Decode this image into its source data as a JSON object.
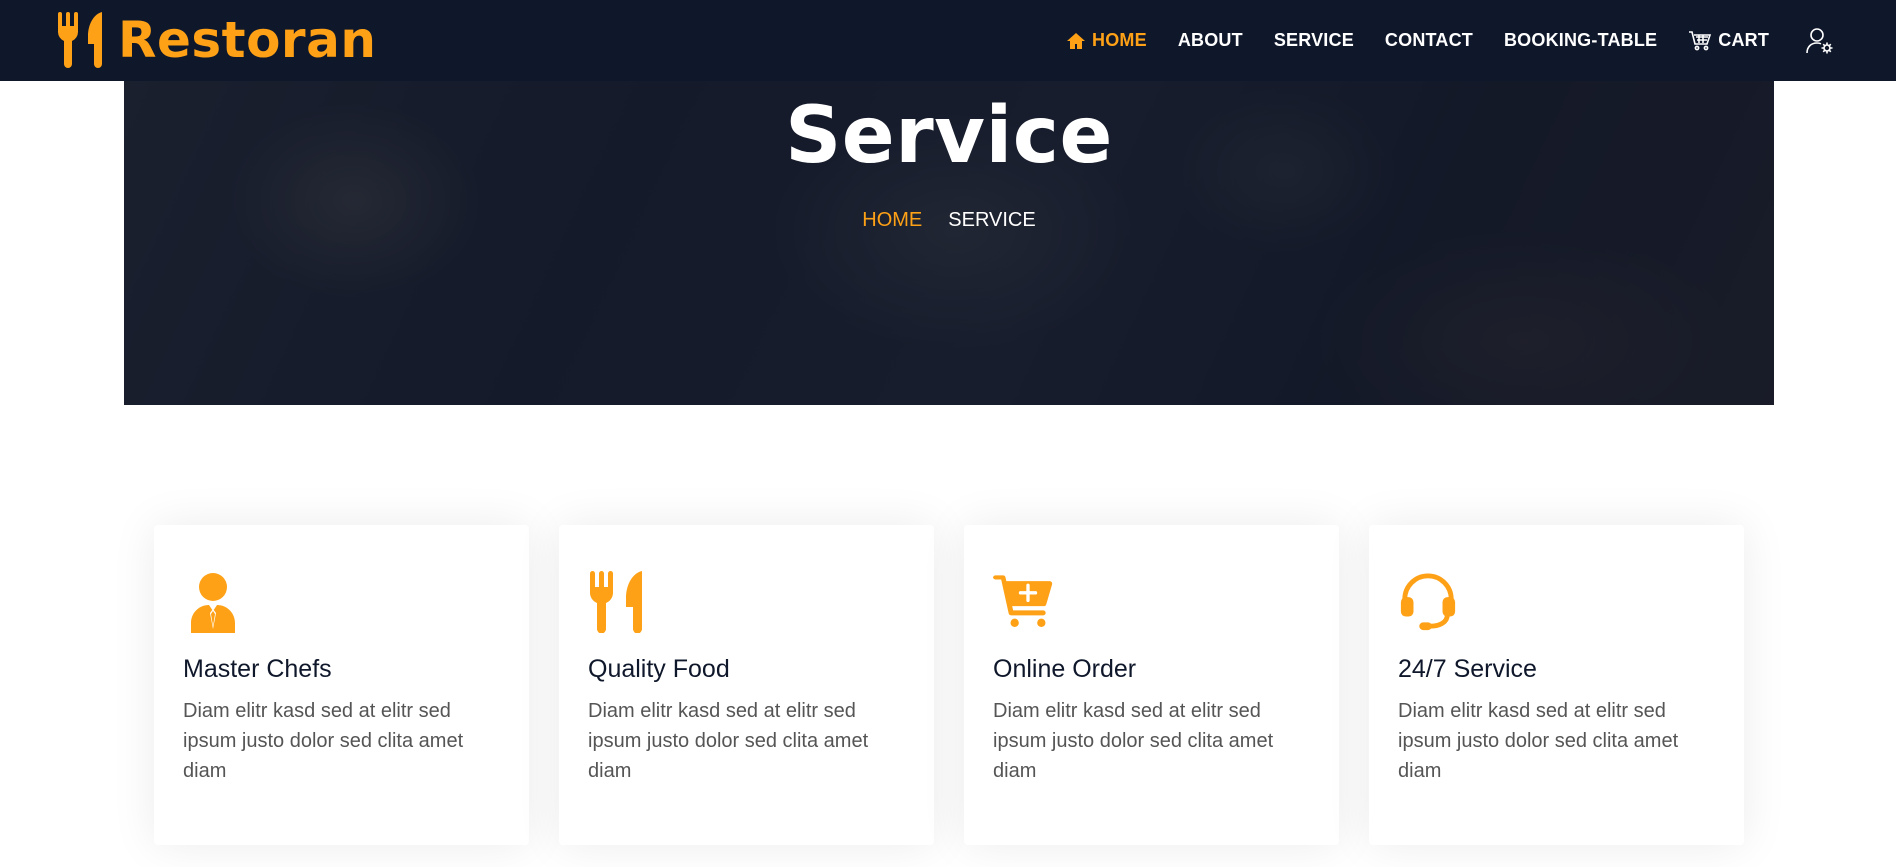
{
  "brand": {
    "name": "Restoran",
    "icon": "utensils-icon"
  },
  "nav": {
    "items": [
      {
        "label": "HOME",
        "icon": "home-icon",
        "active": true
      },
      {
        "label": "ABOUT"
      },
      {
        "label": "SERVICE"
      },
      {
        "label": "CONTACT"
      },
      {
        "label": "BOOKING-TABLE"
      },
      {
        "label": "CART",
        "icon": "cart-icon"
      }
    ],
    "user_icon": "user-settings-icon"
  },
  "hero": {
    "title": "Service",
    "breadcrumb": {
      "home": "HOME",
      "current": "SERVICE"
    }
  },
  "services": [
    {
      "icon": "chef-icon",
      "title": "Master Chefs",
      "text": "Diam elitr kasd sed at elitr sed ipsum justo dolor sed clita amet diam"
    },
    {
      "icon": "utensils-icon",
      "title": "Quality Food",
      "text": "Diam elitr kasd sed at elitr sed ipsum justo dolor sed clita amet diam"
    },
    {
      "icon": "cart-plus-icon",
      "title": "Online Order",
      "text": "Diam elitr kasd sed at elitr sed ipsum justo dolor sed clita amet diam"
    },
    {
      "icon": "headset-icon",
      "title": "24/7 Service",
      "text": "Diam elitr kasd sed at elitr sed ipsum justo dolor sed clita amet diam"
    }
  ],
  "colors": {
    "accent": "#FEA116",
    "dark": "#0f172b",
    "white": "#ffffff"
  }
}
